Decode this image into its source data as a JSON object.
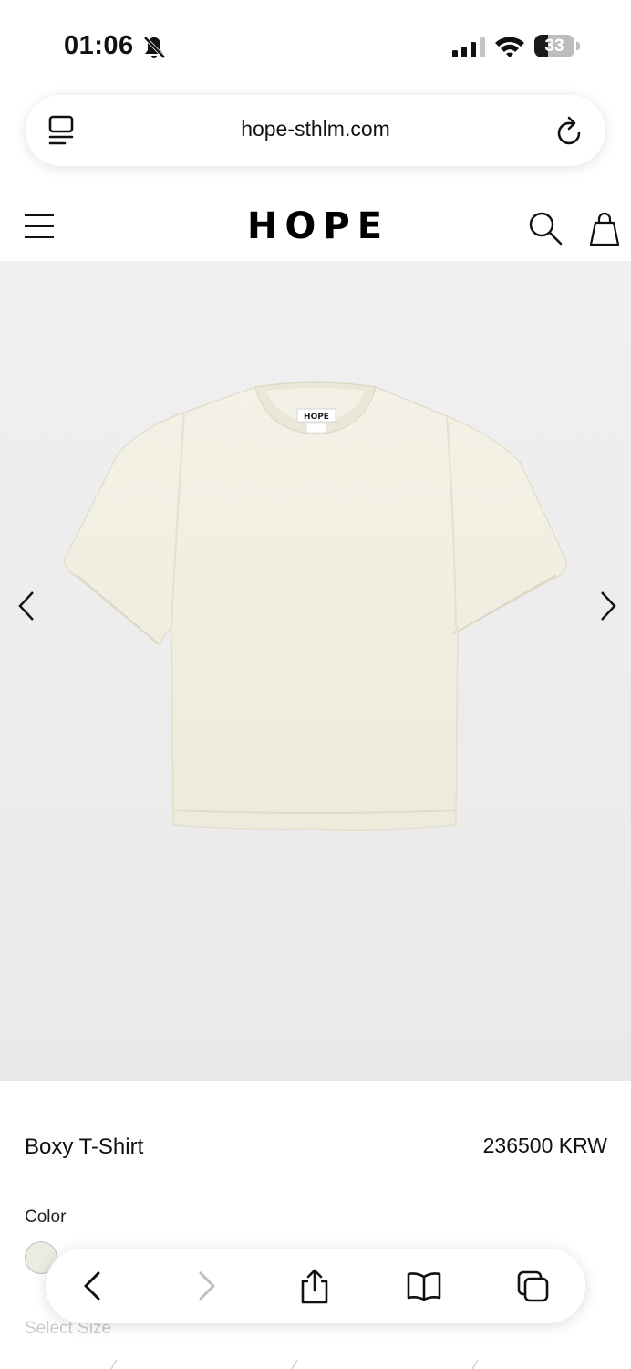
{
  "status_bar": {
    "time": "01:06",
    "battery_level": "33",
    "battery_fraction": 0.33,
    "icons": [
      "bell-slash-icon",
      "cellular-signal-icon",
      "wifi-icon",
      "battery-icon"
    ]
  },
  "browser": {
    "url": "hope-sthlm.com",
    "icons": [
      "tabs-icon",
      "reload-icon"
    ]
  },
  "header": {
    "logo": "HOPE",
    "icons": [
      "menu-icon",
      "search-icon",
      "shopping-bag-icon"
    ]
  },
  "gallery": {
    "image_subject": "cream boxy t-shirt",
    "label_text": "HOPE",
    "icons": [
      "chevron-left-icon",
      "chevron-right-icon"
    ]
  },
  "product": {
    "name": "Boxy T-Shirt",
    "price": "236500 KRW",
    "color_label": "Color",
    "selected_color": "#ecebe2",
    "size_label": "Select Size"
  },
  "toolbar": {
    "icons": [
      "back-icon",
      "forward-icon",
      "share-icon",
      "bookmarks-icon",
      "tabs-overview-icon"
    ]
  }
}
